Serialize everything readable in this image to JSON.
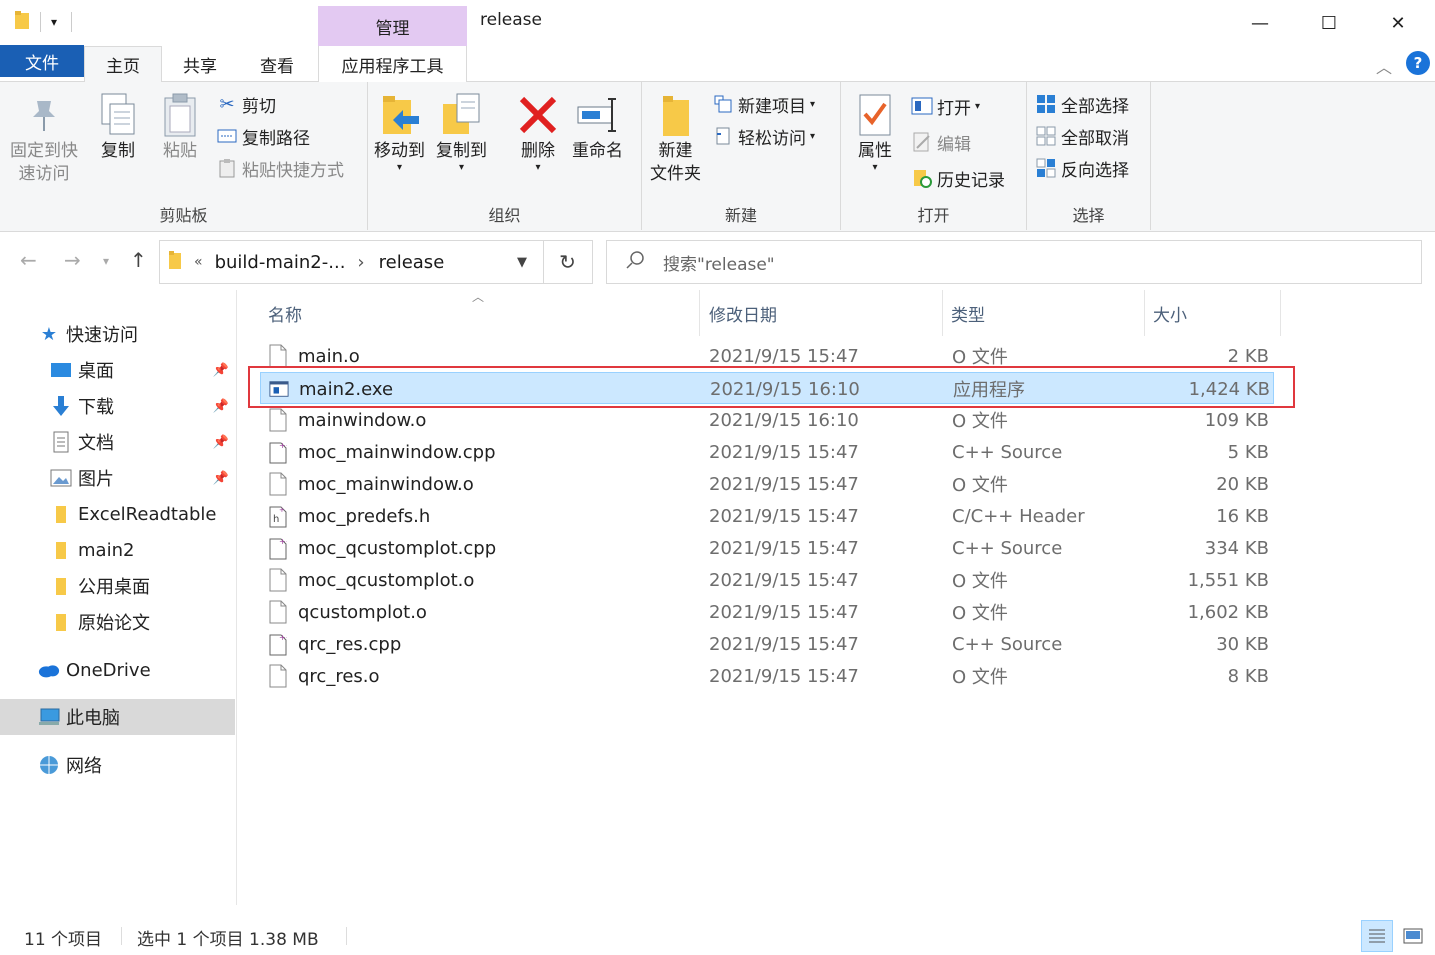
{
  "window": {
    "title": "release",
    "context_tab_header": "管理",
    "minimize": "—",
    "maximize": "☐",
    "close": "✕"
  },
  "tabs": {
    "file": "文件",
    "home": "主页",
    "share": "共享",
    "view": "查看",
    "app_tools": "应用程序工具"
  },
  "ribbon": {
    "clipboard": {
      "label": "剪贴板",
      "pin_quick": "固定到快\n速访问",
      "copy": "复制",
      "paste": "粘贴",
      "cut": "剪切",
      "copy_path": "复制路径",
      "paste_shortcut": "粘贴快捷方式"
    },
    "organize": {
      "label": "组织",
      "move_to": "移动到",
      "copy_to": "复制到",
      "delete": "删除",
      "rename": "重命名"
    },
    "new": {
      "label": "新建",
      "new_folder": "新建\n文件夹",
      "new_item": "新建项目",
      "easy_access": "轻松访问"
    },
    "open": {
      "label": "打开",
      "properties": "属性",
      "open": "打开",
      "edit": "编辑",
      "history": "历史记录"
    },
    "select": {
      "label": "选择",
      "select_all": "全部选择",
      "select_none": "全部取消",
      "invert": "反向选择"
    }
  },
  "address": {
    "chevron": "«",
    "segment1": "build-main2-...",
    "separator": "›",
    "segment2": "release",
    "search_placeholder": "搜索\"release\""
  },
  "nav": {
    "quick_access": "快速访问",
    "desktop": "桌面",
    "downloads": "下载",
    "documents": "文档",
    "pictures": "图片",
    "excel": "ExcelReadtable",
    "main2": "main2",
    "public_desktop": "公用桌面",
    "papers": "原始论文",
    "onedrive": "OneDrive",
    "this_pc": "此电脑",
    "network": "网络"
  },
  "columns": {
    "name": "名称",
    "modified": "修改日期",
    "type": "类型",
    "size": "大小"
  },
  "files": [
    {
      "name": "main.o",
      "modified": "2021/9/15 15:47",
      "type": "O 文件",
      "size": "2 KB",
      "icon": "blank-file-icon"
    },
    {
      "name": "main2.exe",
      "modified": "2021/9/15 16:10",
      "type": "应用程序",
      "size": "1,424 KB",
      "icon": "exe-file-icon"
    },
    {
      "name": "mainwindow.o",
      "modified": "2021/9/15 16:10",
      "type": "O 文件",
      "size": "109 KB",
      "icon": "blank-file-icon"
    },
    {
      "name": "moc_mainwindow.cpp",
      "modified": "2021/9/15 15:47",
      "type": "C++ Source",
      "size": "5 KB",
      "icon": "cpp-file-icon"
    },
    {
      "name": "moc_mainwindow.o",
      "modified": "2021/9/15 15:47",
      "type": "O 文件",
      "size": "20 KB",
      "icon": "blank-file-icon"
    },
    {
      "name": "moc_predefs.h",
      "modified": "2021/9/15 15:47",
      "type": "C/C++ Header",
      "size": "16 KB",
      "icon": "header-file-icon"
    },
    {
      "name": "moc_qcustomplot.cpp",
      "modified": "2021/9/15 15:47",
      "type": "C++ Source",
      "size": "334 KB",
      "icon": "cpp-file-icon"
    },
    {
      "name": "moc_qcustomplot.o",
      "modified": "2021/9/15 15:47",
      "type": "O 文件",
      "size": "1,551 KB",
      "icon": "blank-file-icon"
    },
    {
      "name": "qcustomplot.o",
      "modified": "2021/9/15 15:47",
      "type": "O 文件",
      "size": "1,602 KB",
      "icon": "blank-file-icon"
    },
    {
      "name": "qrc_res.cpp",
      "modified": "2021/9/15 15:47",
      "type": "C++ Source",
      "size": "30 KB",
      "icon": "cpp-file-icon"
    },
    {
      "name": "qrc_res.o",
      "modified": "2021/9/15 15:47",
      "type": "O 文件",
      "size": "8 KB",
      "icon": "blank-file-icon"
    }
  ],
  "selected_index": 1,
  "status": {
    "count": "11 个项目",
    "selection": "选中 1 个项目  1.38 MB"
  },
  "colors": {
    "accent": "#1a5fb4",
    "selection_bg": "#cce8ff",
    "highlight_border": "#e0383e",
    "context_tab": "#e3c9f2",
    "folder": "#f7c948"
  }
}
